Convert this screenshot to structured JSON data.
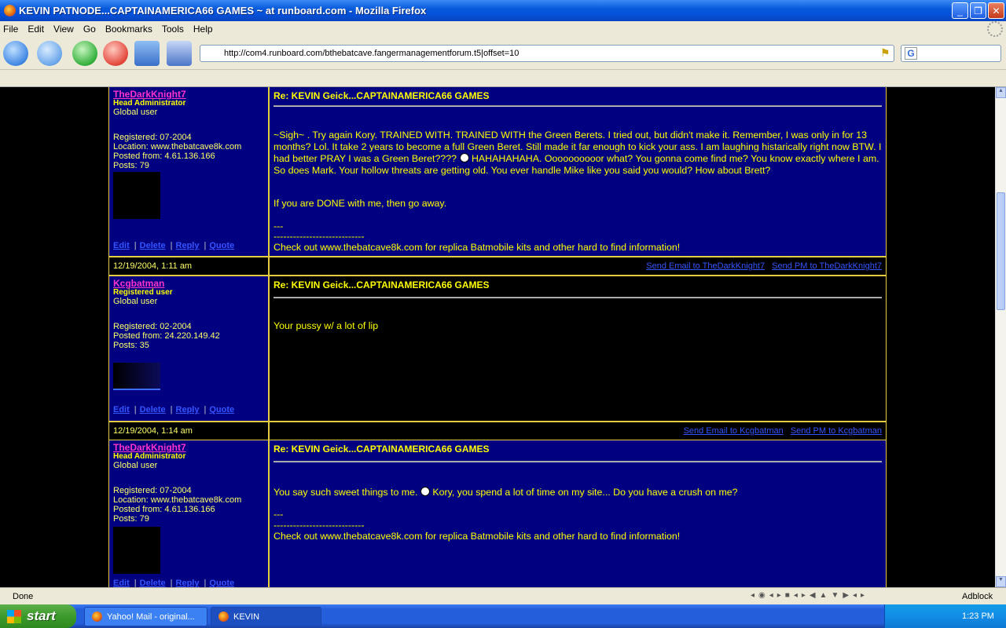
{
  "window": {
    "title": "KEVIN PATNODE...CAPTAINAMERICA66 GAMES ~ at runboard.com - Mozilla Firefox",
    "minimize": "_",
    "maximize": "❐",
    "close": "✕"
  },
  "menu": [
    "File",
    "Edit",
    "View",
    "Go",
    "Bookmarks",
    "Tools",
    "Help"
  ],
  "url": "http://com4.runboard.com/bthebatcave.fangermanagementforum.t5|offset=10",
  "search_engine_glyph": "G",
  "posts": [
    {
      "username": "TheDarkKnight7",
      "role": "Head Administrator",
      "group": "Global user",
      "info": [
        "Registered: 07-2004",
        "Location: www.thebatcave8k.com",
        "Posted from: 4.61.136.166",
        "Posts: 79"
      ],
      "actions": [
        "Edit",
        "Delete",
        "Reply",
        "Quote"
      ],
      "subject": "Re: KEVIN Geick...CAPTAINAMERICA66 GAMES",
      "body_p1a": "~Sigh~ . Try again Kory. TRAINED WITH. TRAINED WITH the Green Berets. I tried out, but didn't make it. Remember, I was only in for 13 months? Lol. It take 2 years to become a full Green Beret. Still made it far enough to kick your ass. I am laughing histarically right now BTW. I had better PRAY I was a Green Beret????",
      "body_p1b": "HAHAHAHAHA. Oooooooooor what? You gonna come find me? You know exactly where I am. So does Mark. Your hollow threats are getting old. You ever handle Mike like you said you would? How about Brett?",
      "body_p2": "If you are DONE with me, then go away.",
      "sig_dashes": "---",
      "sig_line": "----------------------------",
      "sig_text": "Check out www.thebatcave8k.com for replica Batmobile kits and other hard to find information!",
      "date": "12/19/2004, 1:11 am",
      "send_email": "Send Email to TheDarkKnight7",
      "send_pm": "Send PM to TheDarkKnight7"
    },
    {
      "username": "Kcgbatman",
      "role": "Registered user",
      "group": "Global user",
      "info": [
        "Registered: 02-2004",
        "Posted from: 24.220.149.42",
        "Posts: 35"
      ],
      "actions": [
        "Edit",
        "Delete",
        "Reply",
        "Quote"
      ],
      "subject": "Re: KEVIN Geick...CAPTAINAMERICA66 GAMES",
      "body": "Your pussy w/ a lot of lip",
      "date": "12/19/2004, 1:14 am",
      "send_email": "Send Email to Kcgbatman",
      "send_pm": "Send PM to Kcgbatman"
    },
    {
      "username": "TheDarkKnight7",
      "role": "Head Administrator",
      "group": "Global user",
      "info": [
        "Registered: 07-2004",
        "Location: www.thebatcave8k.com",
        "Posted from: 4.61.136.166",
        "Posts: 79"
      ],
      "actions": [
        "Edit",
        "Delete",
        "Reply",
        "Quote"
      ],
      "subject": "Re: KEVIN Geick...CAPTAINAMERICA66 GAMES",
      "body_a": "You say such sweet things to me.",
      "body_b": "Kory, you spend a lot of time on my site... Do you have a crush on me?",
      "sig_dashes": "---",
      "sig_line": "----------------------------",
      "sig_text": "Check out www.thebatcave8k.com for replica Batmobile kits and other hard to find information!"
    }
  ],
  "status": {
    "text": "Done",
    "adblock": "Adblock"
  },
  "taskbar": {
    "start": "start",
    "tasks": [
      "Yahoo! Mail - original...",
      "KEVIN PATNODE...C..."
    ],
    "clock": "1:23 PM"
  }
}
